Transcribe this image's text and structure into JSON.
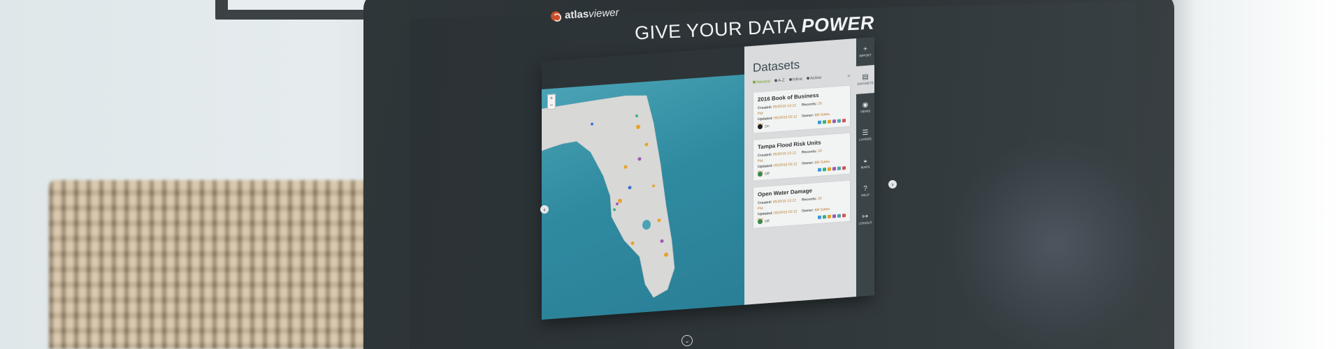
{
  "brand": {
    "name_bold": "atlas",
    "name_italic": "viewer",
    "logo_icon": "atlas-logo-icon"
  },
  "hero": {
    "prefix": "GIVE YOUR DATA ",
    "emphasis": "POWER"
  },
  "window_dots": [
    "#e05a4e",
    "#e8c23a",
    "#6fbf4a"
  ],
  "map": {
    "zoom_in": "+",
    "zoom_out": "−"
  },
  "datasets": {
    "title": "Datasets",
    "sort_options": [
      {
        "label": "Newest",
        "active": true
      },
      {
        "label": "A-Z",
        "active": false
      },
      {
        "label": "Inline",
        "active": false
      },
      {
        "label": "Active",
        "active": false
      }
    ],
    "search_icon": "search-icon",
    "items": [
      {
        "title": "2016 Book of Business",
        "created_label": "Created:",
        "created_value": "05/20/15 12:12 PM",
        "updated_label": "Updated:",
        "updated_value": "05/20/15 02:12 PM",
        "records_label": "Records:",
        "records_value": "20",
        "owner_label": "Owner:",
        "owner_value": "Bill Gates",
        "status": "On"
      },
      {
        "title": "Tampa Flood Risk Units",
        "created_label": "Created:",
        "created_value": "05/20/15 12:12 PM",
        "updated_label": "Updated:",
        "updated_value": "05/20/15 02:12 PM",
        "records_label": "Records:",
        "records_value": "20",
        "owner_label": "Owner:",
        "owner_value": "Bill Gates",
        "status": "Off"
      },
      {
        "title": "Open Water Damage",
        "created_label": "Created:",
        "created_value": "05/20/15 12:12 PM",
        "updated_label": "Updated:",
        "updated_value": "05/20/15 02:12 PM",
        "records_label": "Records:",
        "records_value": "20",
        "owner_label": "Owner:",
        "owner_value": "Bill Gates",
        "status": "Off"
      }
    ],
    "tool_colors": [
      "#3b9ad9",
      "#39b07a",
      "#e0a12e",
      "#9b59b6",
      "#4aa3b5",
      "#d9534f"
    ]
  },
  "sidebar": [
    {
      "icon": "+",
      "label": "IMPORT",
      "active": false
    },
    {
      "icon": "▤",
      "label": "DATASETS",
      "active": true
    },
    {
      "icon": "◉",
      "label": "VIEWS",
      "active": false
    },
    {
      "icon": "☰",
      "label": "LAYERS",
      "active": false
    },
    {
      "icon": "◒",
      "label": "MAPS",
      "active": false
    },
    {
      "icon": "?",
      "label": "HELP",
      "active": false
    },
    {
      "icon": "↦",
      "label": "LOGOUT",
      "active": false
    }
  ],
  "carousel": {
    "prev": "‹",
    "next": "›",
    "down": "⌄"
  }
}
